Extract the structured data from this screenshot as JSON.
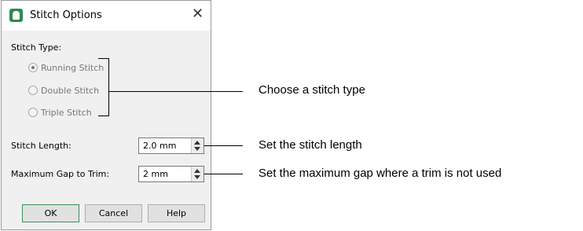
{
  "dialog": {
    "title": "Stitch Options",
    "close_glyph": "✕",
    "stitch_type_label": "Stitch Type:",
    "stitch_types": [
      {
        "label": "Running Stitch",
        "selected": true
      },
      {
        "label": "Double Stitch",
        "selected": false
      },
      {
        "label": "Triple Stitch",
        "selected": false
      }
    ],
    "stitch_length": {
      "label": "Stitch Length:",
      "value": "2.0 mm"
    },
    "max_gap": {
      "label": "Maximum Gap to Trim:",
      "value": "2 mm"
    },
    "buttons": {
      "ok": "OK",
      "cancel": "Cancel",
      "help": "Help"
    }
  },
  "annotations": {
    "stitch_type": "Choose a stitch type",
    "stitch_length": "Set the stitch length",
    "max_gap": "Set the maximum gap where a trim is not used"
  },
  "colors": {
    "accent": "#2f8a4e",
    "dialog_bg": "#f0f0f0"
  },
  "icons": {
    "app": "stitch-options-app-icon",
    "close": "close-icon"
  }
}
